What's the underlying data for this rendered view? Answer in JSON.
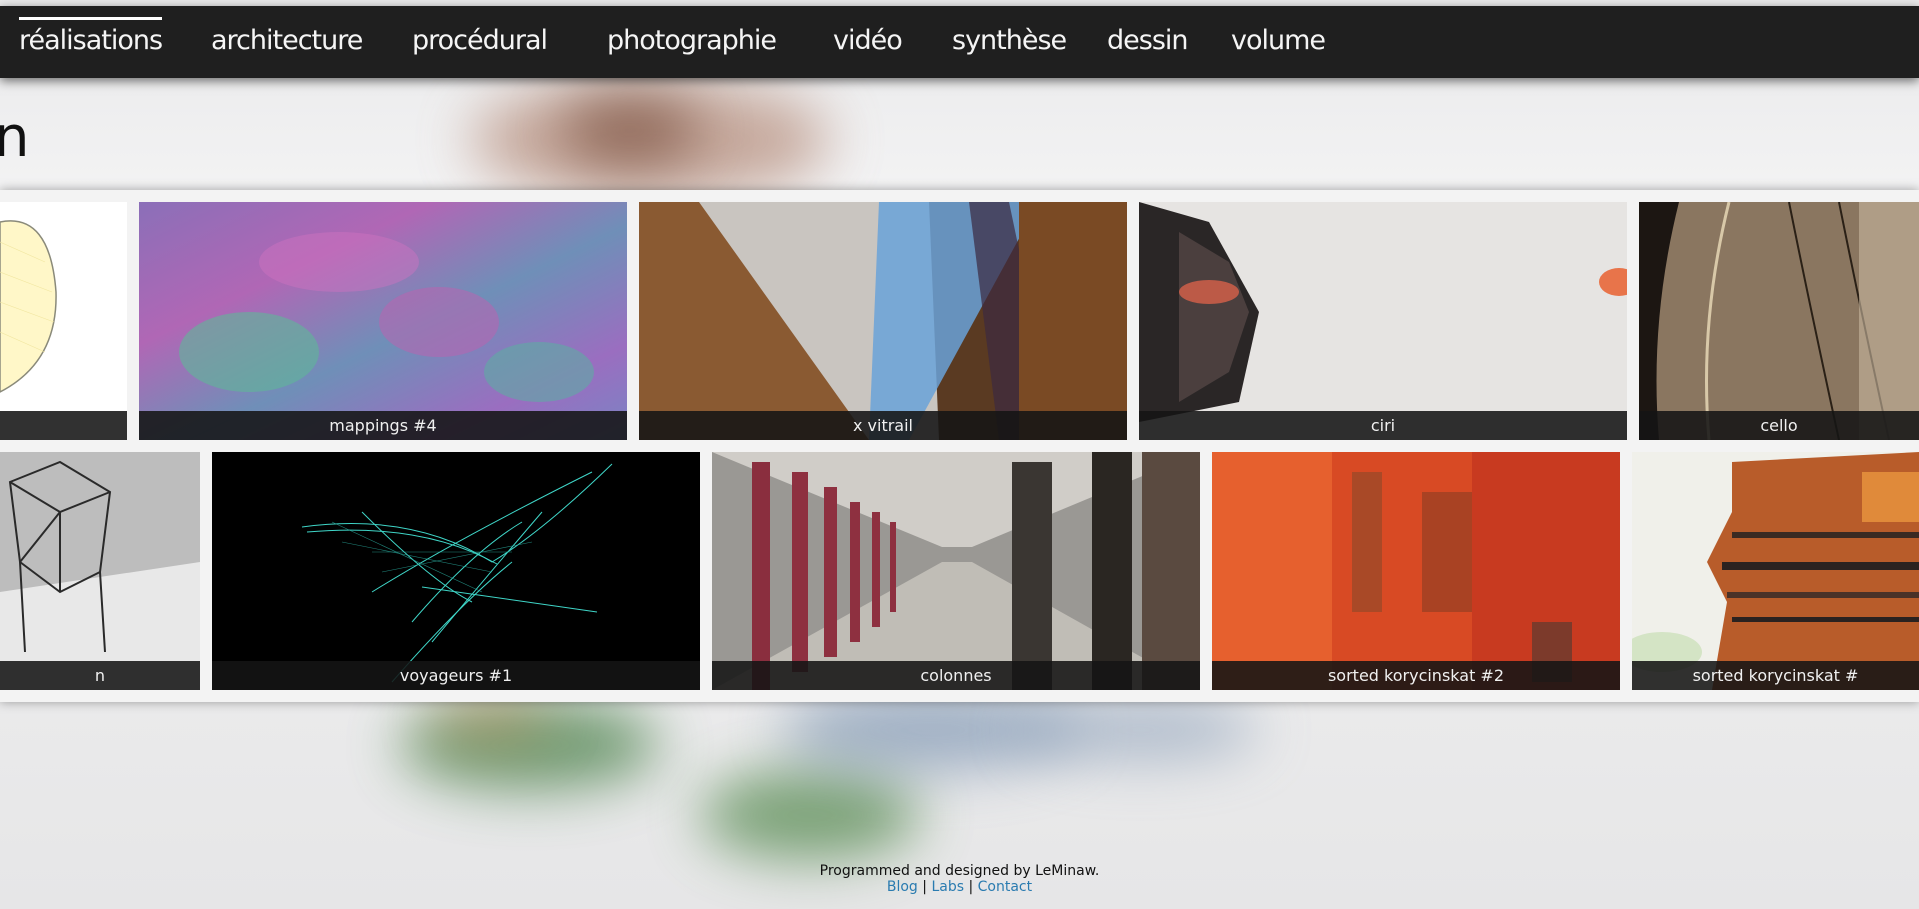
{
  "nav": {
    "items": [
      {
        "label": "réalisations",
        "active": true
      },
      {
        "label": "architecture",
        "active": false
      },
      {
        "label": "procédural",
        "active": false
      },
      {
        "label": "photographie",
        "active": false
      },
      {
        "label": "vidéo",
        "active": false
      },
      {
        "label": "synthèse",
        "active": false
      },
      {
        "label": "dessin",
        "active": false
      },
      {
        "label": "volume",
        "active": false
      }
    ]
  },
  "heading_fragment": "n",
  "gallery": {
    "row1": [
      {
        "caption": ""
      },
      {
        "caption": "mappings #4"
      },
      {
        "caption": "x vitrail"
      },
      {
        "caption": "ciri"
      },
      {
        "caption": "cello"
      }
    ],
    "row2": [
      {
        "caption": "n"
      },
      {
        "caption": "voyageurs #1"
      },
      {
        "caption": "colonnes"
      },
      {
        "caption": "sorted korycinskat #2"
      },
      {
        "caption": "sorted korycinskat #"
      }
    ]
  },
  "footer": {
    "credit": "Programmed and designed by LeMinaw.",
    "links": [
      "Blog",
      "Labs",
      "Contact"
    ],
    "separator": "|",
    "link_color": "#2a7bb0"
  },
  "colors": {
    "nav_bg": "#1f1f1f",
    "caption_bg": "#141414"
  }
}
